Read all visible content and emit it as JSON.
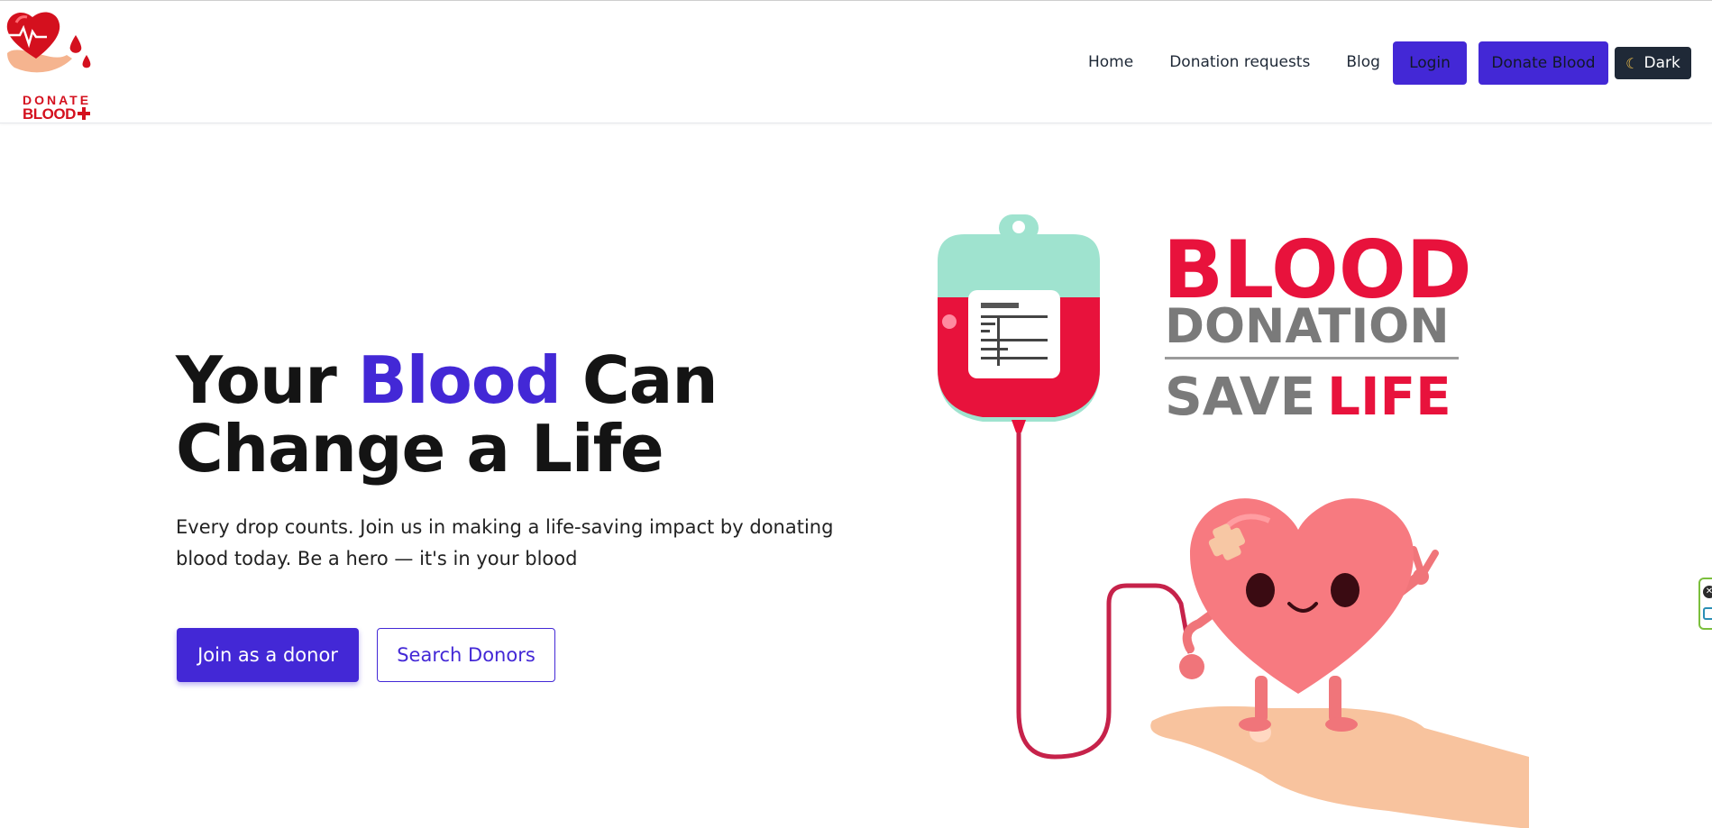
{
  "logo": {
    "line1": "DONATE",
    "line2": "BLOOD"
  },
  "nav": {
    "links": [
      "Home",
      "Donation requests",
      "Blog"
    ],
    "login_label": "Login",
    "donate_label": "Donate Blood",
    "theme_label": "Dark",
    "theme_icon": "moon-icon"
  },
  "hero": {
    "title_part1": "Your ",
    "title_accent": "Blood",
    "title_part2": " Can",
    "title_line2": "Change a Life",
    "subtitle": "Every drop counts. Join us in making a life-saving impact by donating blood today. Be a hero — it's in your blood",
    "join_button": "Join as a donor",
    "search_button": "Search Donors"
  },
  "illustration": {
    "headline": "BLOOD",
    "line2": "DONATION",
    "line3_a": "SAVE",
    "line3_b": "LIFE"
  },
  "colors": {
    "accent": "#4328d6",
    "blood_red": "#e8123c",
    "dark_button": "#1f2937"
  }
}
